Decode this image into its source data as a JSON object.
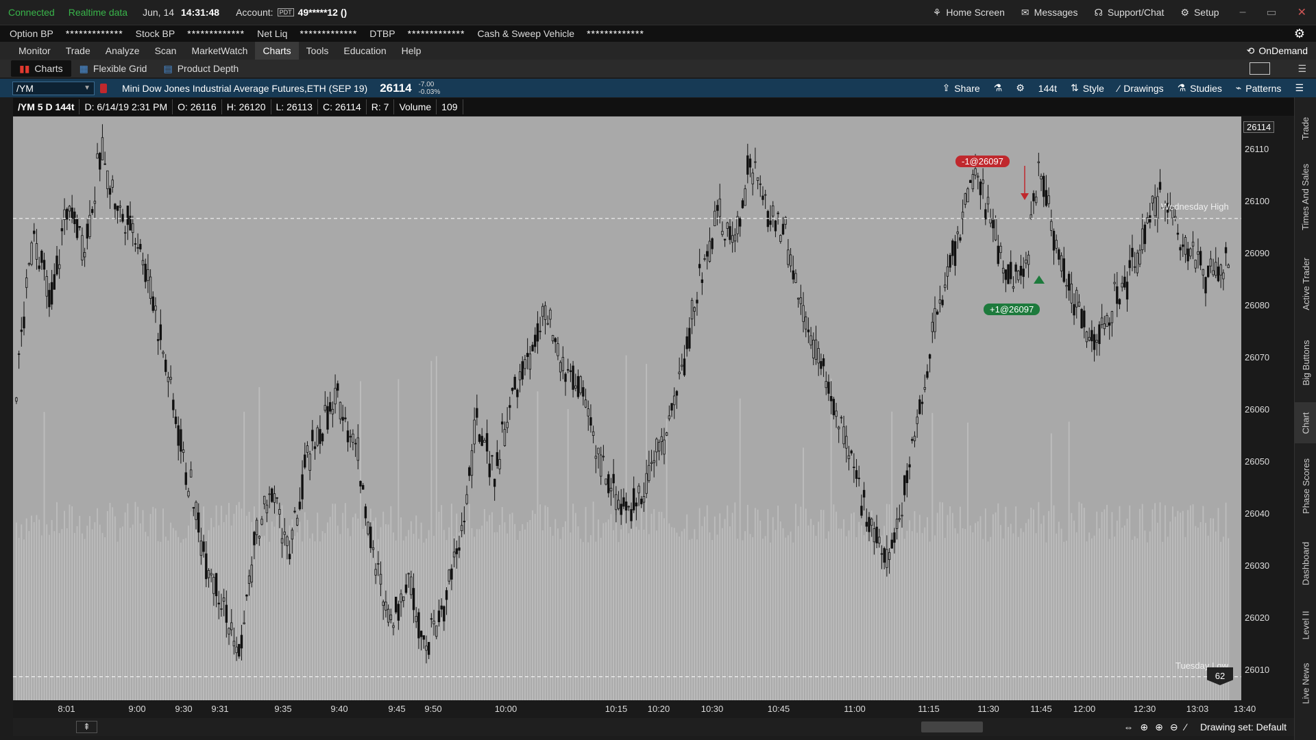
{
  "status": {
    "connected": "Connected",
    "realtime": "Realtime data",
    "date": "Jun, 14",
    "time": "14:31:48",
    "account_label": "Account:",
    "account_badge": "PDT",
    "account_value": "49*****12 ()"
  },
  "topright": {
    "home": "Home Screen",
    "messages": "Messages",
    "support": "Support/Chat",
    "setup": "Setup"
  },
  "balances": {
    "option_bp": "Option BP",
    "option_bp_val": "*************",
    "stock_bp": "Stock BP",
    "stock_bp_val": "*************",
    "net_liq": "Net Liq",
    "net_liq_val": "*************",
    "dtbp": "DTBP",
    "dtbp_val": "*************",
    "cash": "Cash & Sweep Vehicle",
    "cash_val": "*************"
  },
  "nav": {
    "tabs": [
      "Monitor",
      "Trade",
      "Analyze",
      "Scan",
      "MarketWatch",
      "Charts",
      "Tools",
      "Education",
      "Help"
    ],
    "ondemand": "OnDemand"
  },
  "subnav": {
    "charts": "Charts",
    "flexible_grid": "Flexible Grid",
    "product_depth": "Product Depth"
  },
  "symbol": {
    "ticker": "/YM",
    "description": "Mini Dow Jones Industrial Average Futures,ETH (SEP 19)",
    "price": "26114",
    "change": "-7.00",
    "change_pct": "-0.03%",
    "share": "Share",
    "aggregation": "144t",
    "style": "Style",
    "drawings": "Drawings",
    "studies": "Studies",
    "patterns": "Patterns"
  },
  "infobar": {
    "symbol": "/YM 5 D 144t",
    "date": "D: 6/14/19 2:31 PM",
    "open": "O: 26116",
    "high": "H: 26120",
    "low": "L: 26113",
    "close": "C: 26114",
    "range": "R: 7",
    "volume_label": "Volume",
    "volume": "109"
  },
  "chart_data": {
    "type": "candlestick",
    "current_price": "26114",
    "y_ticks": [
      "26110",
      "26100",
      "26090",
      "26080",
      "26070",
      "26060",
      "26050",
      "26040",
      "26030",
      "26020",
      "26010"
    ],
    "x_ticks": [
      "8:01",
      "9:00",
      "9:30",
      "9:31",
      "9:35",
      "9:40",
      "9:45",
      "9:50",
      "10:00",
      "10:15",
      "10:20",
      "10:30",
      "10:45",
      "11:00",
      "11:15",
      "11:30",
      "11:45",
      "12:00",
      "12:30",
      "13:03",
      "13:40"
    ],
    "price_path": [
      26065,
      26095,
      26080,
      26100,
      26092,
      26110,
      26098,
      26095,
      26082,
      26065,
      26048,
      26033,
      26025,
      26012,
      26035,
      26045,
      26032,
      26050,
      26058,
      26062,
      26052,
      26030,
      26020,
      26028,
      26015,
      26022,
      26035,
      26058,
      26048,
      26062,
      26070,
      26078,
      26068,
      26065,
      26052,
      26045,
      26040,
      26048,
      26055,
      26068,
      26085,
      26098,
      26092,
      26108,
      26098,
      26095,
      26080,
      26070,
      26060,
      26048,
      26040,
      26030,
      26045,
      26062,
      26080,
      26092,
      26105,
      26098,
      26086,
      26085,
      26108,
      26090,
      26082,
      26072,
      26078,
      26085,
      26092,
      26102,
      26095,
      26090,
      26085,
      26088
    ],
    "reference_lines": [
      {
        "label": "Wednesday High",
        "value": 26097
      },
      {
        "label": "Tuesday Low",
        "value": 26009
      }
    ],
    "trades": [
      {
        "label": "-1@26097",
        "side": "sell"
      },
      {
        "label": "+1@26097",
        "side": "buy"
      }
    ],
    "badge": "62",
    "colors": {
      "background": "#a9a9a9",
      "candle": "#111111",
      "volume": "#bdbdbd",
      "sell": "#c0282d",
      "buy": "#1d7a3c"
    }
  },
  "bottom": {
    "drawing_set": "Drawing set: Default"
  },
  "side_tabs": [
    "Trade",
    "Times And Sales",
    "Active Trader",
    "Big Buttons",
    "Chart",
    "Phase Scores",
    "Dashboard",
    "Level II",
    "Live News"
  ]
}
